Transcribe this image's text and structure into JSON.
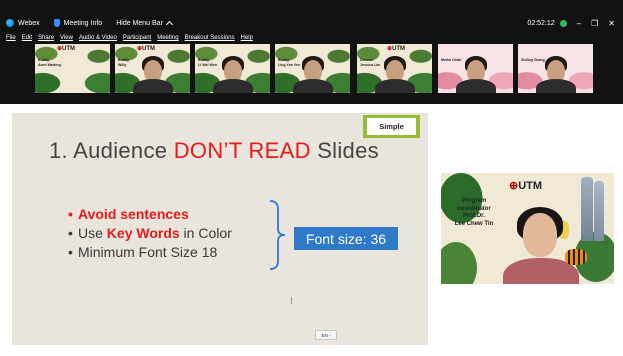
{
  "window": {
    "app_name": "Webex",
    "meeting_info_label": "Meeting Info",
    "hide_menu_label": "Hide Menu Bar",
    "timer": "02:52:12",
    "minimize": "–",
    "restore": "❐",
    "close": "✕"
  },
  "menu": [
    "File",
    "Edit",
    "Share",
    "View",
    "Audio & Video",
    "Participant",
    "Meeting",
    "Breakout Sessions",
    "Help"
  ],
  "participants": [
    {
      "label": "Buddy\nAzmi Maizing",
      "bg": "jungle"
    },
    {
      "label": "Buddy\nWilly",
      "bg": "jungle"
    },
    {
      "label": "Buddy\nLi Wei Wen",
      "bg": "jungle"
    },
    {
      "label": "Buddy\nLing Yan Yee",
      "bg": "jungle"
    },
    {
      "label": "Director\nJessica Lim",
      "bg": "jungle"
    },
    {
      "label": "Meiko Oraki",
      "bg": "pink"
    },
    {
      "label": "Shiling Zhang",
      "bg": "pink"
    }
  ],
  "slide": {
    "badge": "Simple",
    "title_number": "1. ",
    "title_pre": "Audience ",
    "title_red": "DON’T READ",
    "title_post": " Slides",
    "bullet1": "Avoid sentences",
    "bullet2_pre": "Use ",
    "bullet2_red": "Key Words",
    "bullet2_post": " in Color",
    "bullet3": "Minimum Font Size 18",
    "font_box": "Font size: 36",
    "page_indicator": "EN ▫"
  },
  "speaker": {
    "logo": "UTM",
    "caption": "Program\ncoordinator\nProf.Dr.\nLee Chew Tin"
  },
  "colors": {
    "topbar": "#121212",
    "accent_red": "#e31b1b",
    "badge_green": "#99bb33",
    "font_box_blue": "#2e79c8",
    "recording_green": "#2bbf5a"
  }
}
